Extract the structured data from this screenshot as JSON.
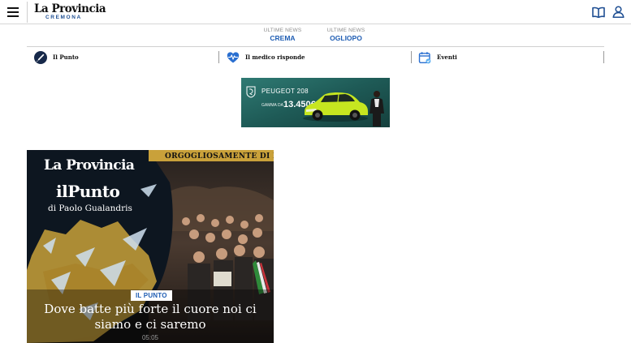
{
  "header": {
    "logo_main": "La Provincia",
    "logo_sub": "CREMONA",
    "menu_icon": "hamburger-menu-icon",
    "edition_icon": "open-book-icon",
    "account_icon": "user-icon"
  },
  "ultime_news": [
    {
      "kicker": "ULTIME NEWS",
      "city": "CREMA"
    },
    {
      "kicker": "ULTIME NEWS",
      "city": "OGLIOPO"
    }
  ],
  "sections": [
    {
      "label": "Il Punto",
      "icon": "pen-nib-icon"
    },
    {
      "label": "Il medico risponde",
      "icon": "heart-pulse-icon"
    },
    {
      "label": "Eventi",
      "icon": "calendar-icon"
    }
  ],
  "ad": {
    "brand": "PEUGEOT 208",
    "price_prefix": "GAMMA DA",
    "price": "13.450€"
  },
  "feature": {
    "strap": "ORGOGLIOSAMENTE DI PI",
    "logo": "La Provincia",
    "column_title": "ilPunto",
    "author": "di Paolo Gualandris",
    "badge": "IL PUNTO",
    "title": "Dove batte più forte il cuore noi ci siamo e ci saremo",
    "time": "05:05"
  },
  "colors": {
    "accent_blue": "#1f5db3",
    "logo_blue": "#1f4f93",
    "ad_teal": "#2f7a73",
    "car_green": "#c6e620",
    "strap_gold": "#c9a13a"
  }
}
